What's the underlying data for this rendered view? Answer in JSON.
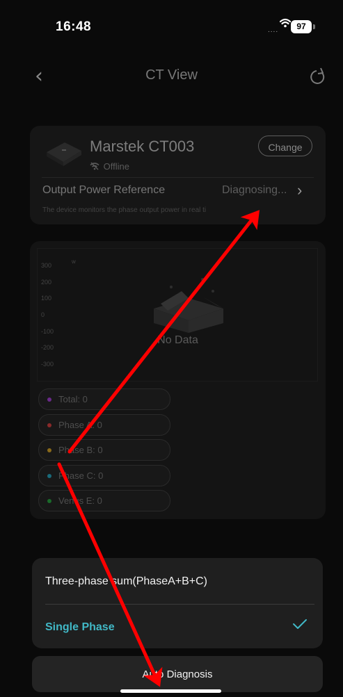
{
  "status_bar": {
    "time": "16:48",
    "signal": "....",
    "battery": "97"
  },
  "nav": {
    "title": "CT View"
  },
  "device": {
    "name": "Marstek CT003",
    "status": "Offline",
    "change_label": "Change",
    "opr_label": "Output Power Reference",
    "opr_value": "Diagnosing...",
    "description": "The device monitors the phase output power in real ti"
  },
  "chart_data": {
    "type": "line",
    "ylabel": "w",
    "y_ticks": [
      "300",
      "200",
      "100",
      "0",
      "-100",
      "-200",
      "-300"
    ],
    "ylim": [
      -300,
      300
    ],
    "empty_label": "No Data",
    "series": []
  },
  "legend": [
    {
      "label": "Total: 0",
      "color": "#6a2a8a"
    },
    {
      "label": "Phase A: 0",
      "color": "#8a2a2a"
    },
    {
      "label": "Phase B: 0",
      "color": "#8a6a1a"
    },
    {
      "label": "Phase C: 0",
      "color": "#1a6a7a"
    },
    {
      "label": "Venus E: 0",
      "color": "#1a6a2a"
    }
  ],
  "sheet": {
    "option1": "Three-phase sum(PhaseA+B+C)",
    "option2": "Single Phase",
    "auto_diagnosis": "Auto Diagnosis"
  },
  "colors": {
    "accent": "#41b8c6",
    "arrow": "#ff0000"
  }
}
